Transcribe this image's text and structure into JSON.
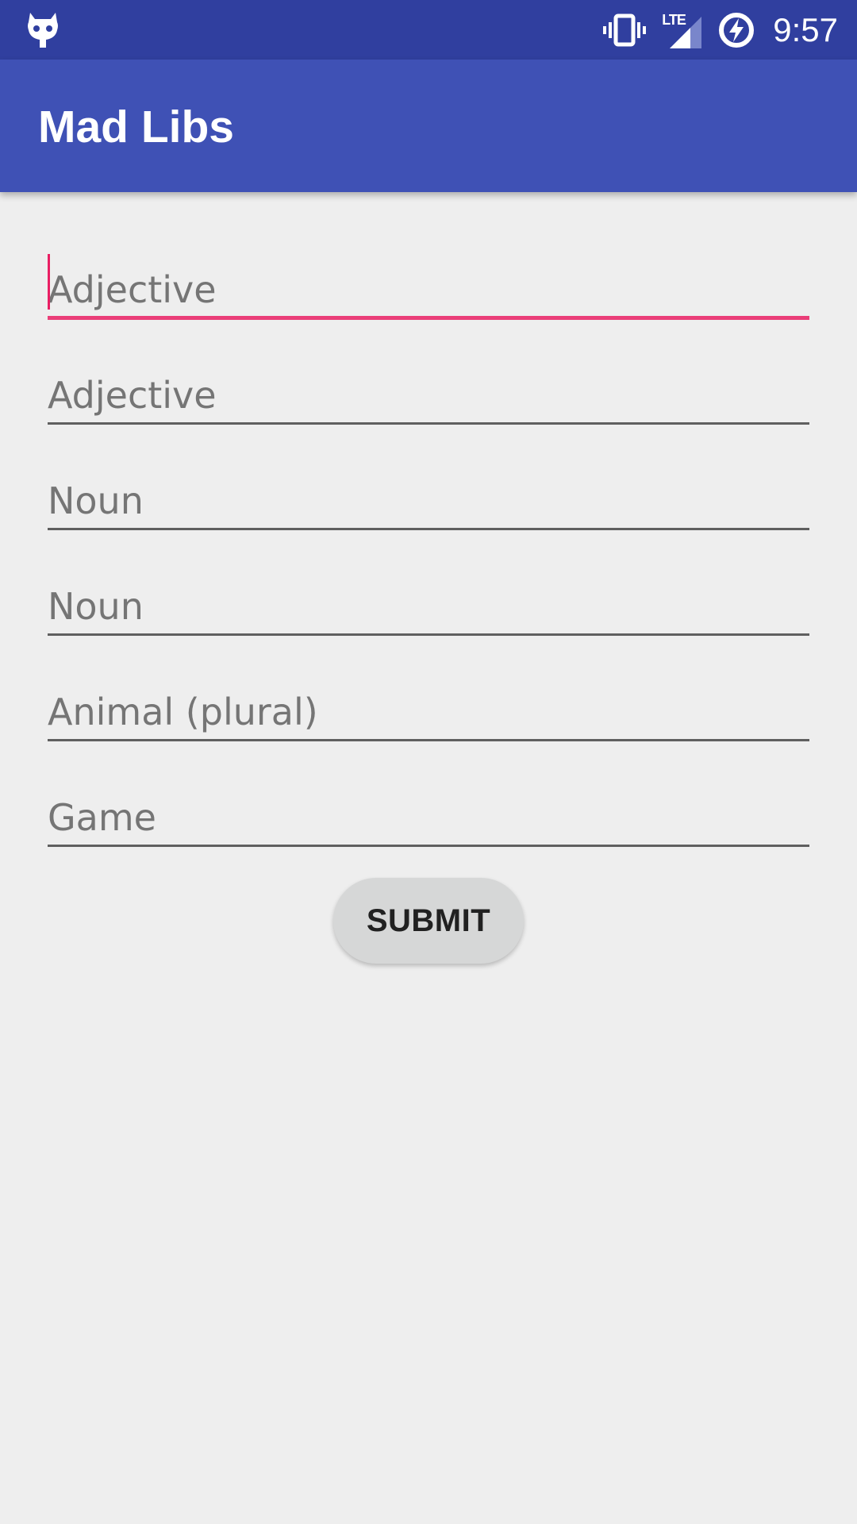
{
  "status_bar": {
    "time": "9:57",
    "network_type": "LTE",
    "icons": [
      "cyanogen-icon",
      "vibrate-icon",
      "lte-signal-icon",
      "battery-charging-icon"
    ],
    "background_color": "#303f9f"
  },
  "app_bar": {
    "title": "Mad Libs",
    "background_color": "#3f51b5"
  },
  "form": {
    "fields": [
      {
        "placeholder": "Adjective",
        "value": "",
        "focused": true
      },
      {
        "placeholder": "Adjective",
        "value": "",
        "focused": false
      },
      {
        "placeholder": "Noun",
        "value": "",
        "focused": false
      },
      {
        "placeholder": "Noun",
        "value": "",
        "focused": false
      },
      {
        "placeholder": "Animal (plural)",
        "value": "",
        "focused": false
      },
      {
        "placeholder": "Game",
        "value": "",
        "focused": false
      }
    ],
    "submit_label": "SUBMIT",
    "accent_color": "#e91e63"
  }
}
